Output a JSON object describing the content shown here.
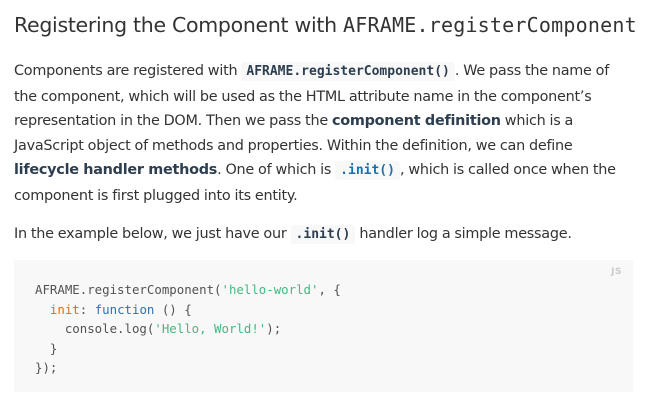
{
  "heading": {
    "text": "Registering the Component with ",
    "code": "AFRAME.registerComponent"
  },
  "paragraph1": {
    "line1_a": "Components are registered with ",
    "line1_code": "AFRAME.registerComponent()",
    "line1_b": ". We pass the name of",
    "line2": "the component, which will be used as the HTML attribute name in the component’s",
    "line3_a": "representation in the DOM. Then we pass the ",
    "line3_bold": "component definition",
    "line3_b": " which is a",
    "line4": "JavaScript object of methods and properties. Within the definition, we can define",
    "line5_bold": "lifecycle handler methods",
    "line5_a": ". One of which is ",
    "line5_code": ".init()",
    "line5_b": ", which is called once when the",
    "line6": "component is first plugged into its entity."
  },
  "paragraph2": {
    "text_a": "In the example below, we just have our ",
    "code": ".init()",
    "text_b": " handler log a simple message."
  },
  "code_block": {
    "language_label": "JS",
    "line1_a": "AFRAME.registerComponent(",
    "line1_str": "'hello-world'",
    "line1_b": ", {",
    "line2_indent": "  ",
    "line2_key": "init",
    "line2_a": ": ",
    "line2_kw": "function",
    "line2_b": " () {",
    "line3_a": "    console.log(",
    "line3_str": "'Hello, World!'",
    "line3_b": ");",
    "line4": "  }",
    "line5": "});"
  },
  "colors": {
    "text": "#333333",
    "code_background": "#f8f8f8",
    "string": "#42b983",
    "keyword": "#2973b7",
    "property": "#e96900"
  }
}
